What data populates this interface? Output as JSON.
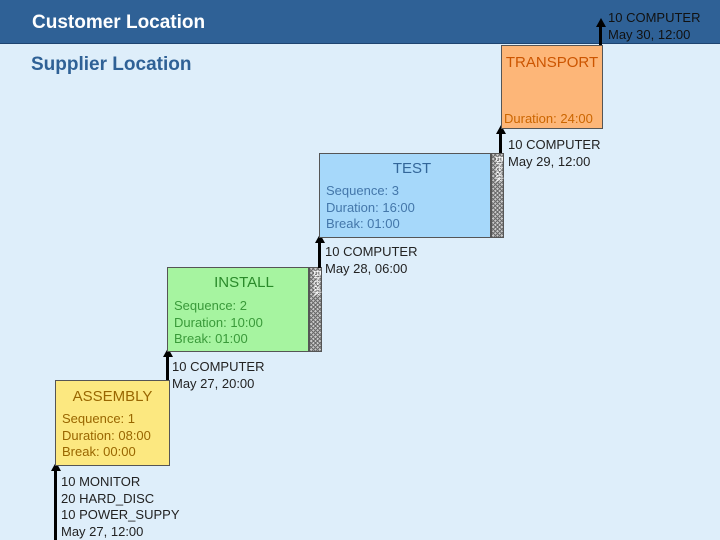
{
  "header": {
    "title": "Customer Location"
  },
  "subtitle": "Supplier Location",
  "colors": {
    "header": "#2f6196",
    "assembly": "#fce880",
    "install": "#a6f4a0",
    "test": "#a6d8fa",
    "transport": "#fdb678"
  },
  "notes": {
    "start": [
      "10 MONITOR",
      "20 HARD_DISC",
      "10 POWER_SUPPY",
      "May 27, 12:00"
    ],
    "after_assembly": [
      "10 COMPUTER",
      "May 27, 20:00"
    ],
    "after_install": [
      "10 COMPUTER",
      "May 28, 06:00"
    ],
    "after_test": [
      "10 COMPUTER",
      "May 29, 12:00"
    ],
    "after_transport": [
      "10 COMPUTER",
      "May 30, 12:00"
    ]
  },
  "steps": {
    "assembly": {
      "title": "ASSEMBLY",
      "sequence": "Sequence: 1",
      "duration": "Duration: 08:00",
      "break": "Break: 00:00"
    },
    "install": {
      "title": "INSTALL",
      "sequence": "Sequence: 2",
      "duration": "Duration: 10:00",
      "break": "Break: 01:00",
      "break_label": "Break"
    },
    "test": {
      "title": "TEST",
      "sequence": "Sequence: 3",
      "duration": "Duration: 16:00",
      "break": "Break: 01:00",
      "break_label": "Break"
    },
    "transport": {
      "title": "TRANSPORT",
      "duration": "Duration: 24:00"
    }
  }
}
